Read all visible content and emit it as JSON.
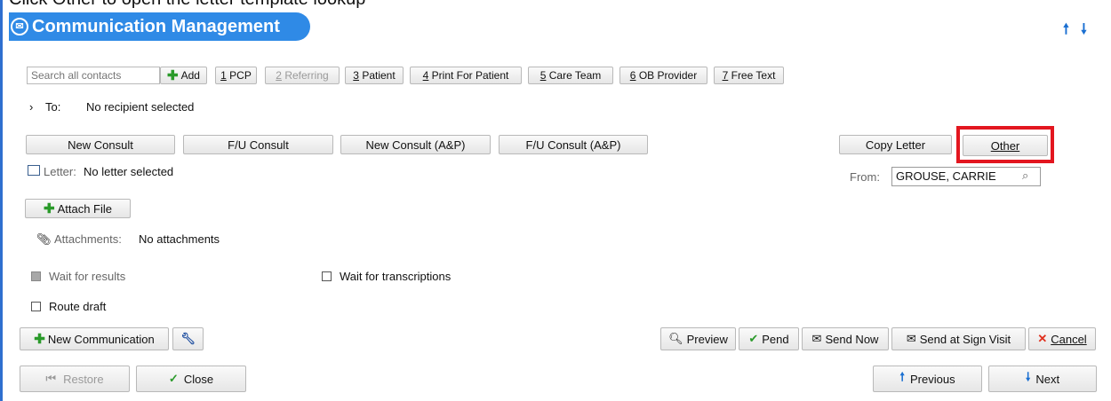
{
  "top_clip_text": "Click Other to open the letter template lookup",
  "header": {
    "title": "Communication Management"
  },
  "recipients": {
    "search_placeholder": "Search all contacts",
    "add_label": "Add",
    "buttons": [
      {
        "num": "1",
        "label": "PCP",
        "disabled": false
      },
      {
        "num": "2",
        "label": "Referring",
        "disabled": true
      },
      {
        "num": "3",
        "label": "Patient",
        "disabled": false
      },
      {
        "num": "4",
        "label": "Print For Patient",
        "disabled": false
      },
      {
        "num": "5",
        "label": "Care Team",
        "disabled": false
      },
      {
        "num": "6",
        "label": "OB Provider",
        "disabled": false
      },
      {
        "num": "7",
        "label": "Free Text",
        "disabled": false
      }
    ],
    "to_label": "To:",
    "to_value": "No recipient selected"
  },
  "templates": {
    "buttons": [
      "New Consult",
      "F/U Consult",
      "New Consult (A&P)",
      "F/U Consult (A&P)"
    ],
    "copy_letter": "Copy Letter",
    "other": "Other"
  },
  "letter": {
    "label": "Letter:",
    "value": "No letter selected"
  },
  "from": {
    "label": "From:",
    "value": "GROUSE, CARRIE"
  },
  "attach": {
    "button": "Attach File",
    "attachments_label": "Attachments:",
    "attachments_value": "No attachments"
  },
  "options": {
    "wait_results": "Wait for results",
    "wait_transcriptions": "Wait for transcriptions",
    "route_draft": "Route draft"
  },
  "actions": {
    "new_communication": "New Communication",
    "preview": "Preview",
    "pend": "Pend",
    "send_now": "Send Now",
    "send_at_sign": "Send at Sign Visit",
    "cancel": "Cancel"
  },
  "footer": {
    "restore": "Restore",
    "close": "Close",
    "previous": "Previous",
    "next": "Next"
  }
}
